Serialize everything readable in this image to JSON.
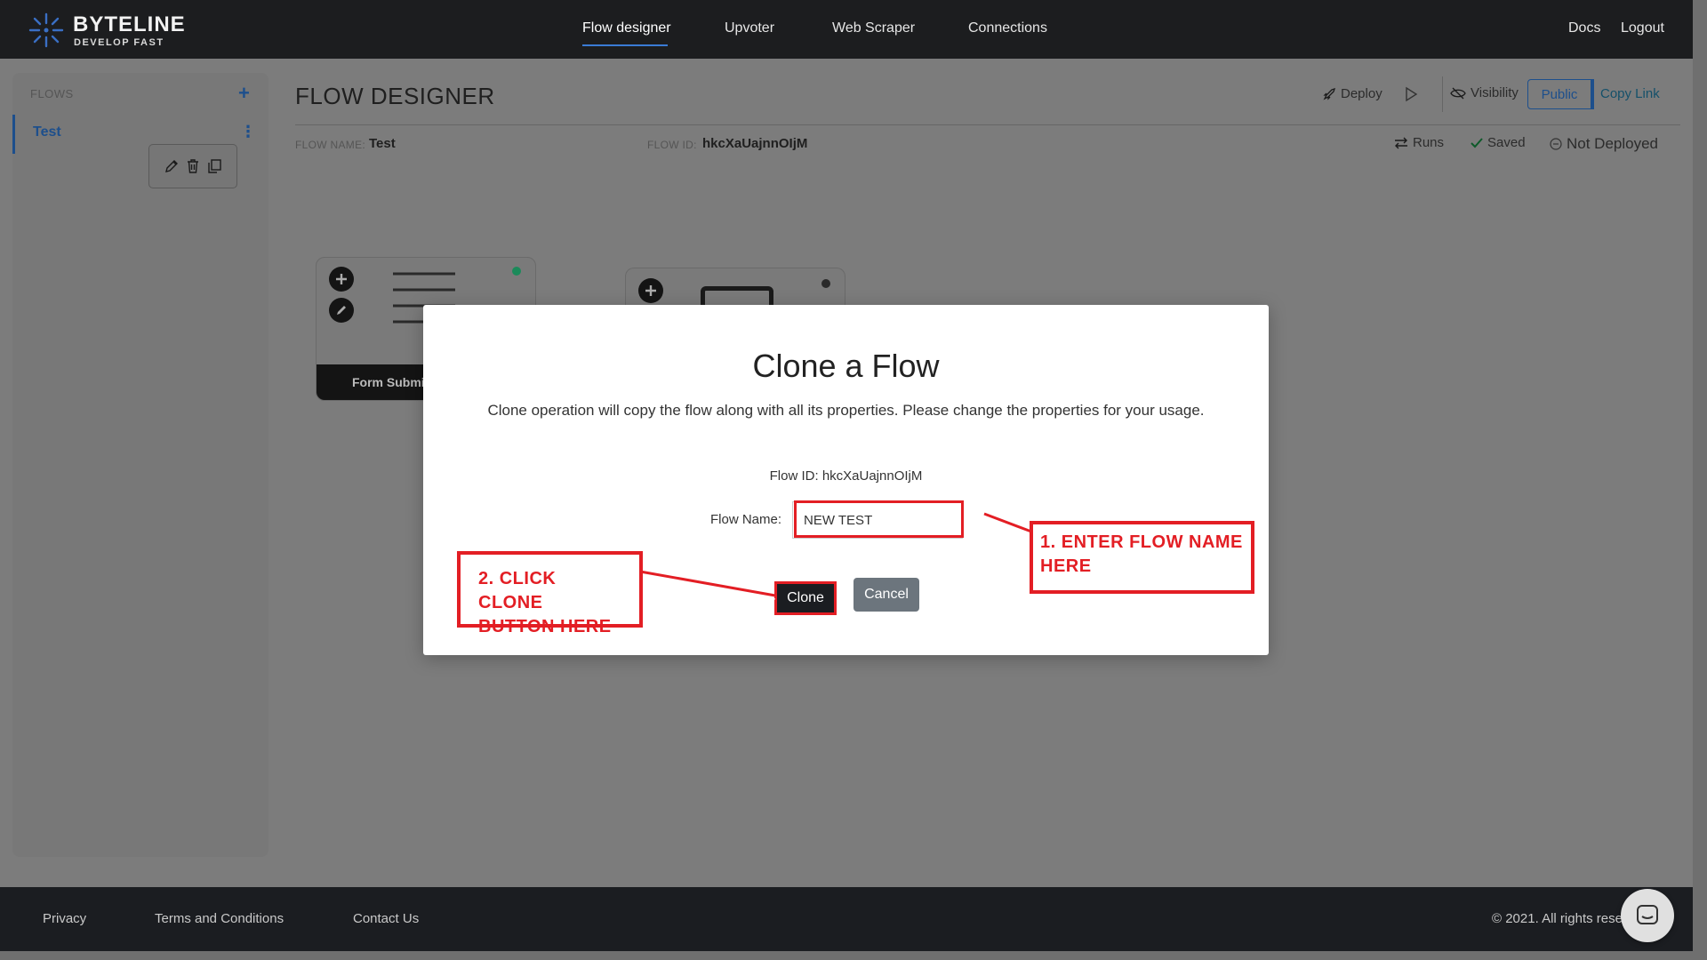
{
  "brand": {
    "name": "BYTELINE",
    "tagline": "DEVELOP FAST"
  },
  "nav": {
    "items": [
      {
        "label": "Flow designer",
        "active": true
      },
      {
        "label": "Upvoter"
      },
      {
        "label": "Web Scraper"
      },
      {
        "label": "Connections"
      }
    ],
    "docs": "Docs",
    "logout": "Logout"
  },
  "sidebar": {
    "title": "FLOWS",
    "add_icon": "plus-icon",
    "items": [
      {
        "label": "Test",
        "active": true
      }
    ],
    "item_actions": [
      "pencil-icon",
      "trash-icon",
      "copy-icon"
    ]
  },
  "header": {
    "title": "FLOW DESIGNER",
    "deploy": "Deploy",
    "visibility": "Visibility",
    "public": "Public",
    "copy_link": "Copy Link",
    "flow_name_label": "FLOW NAME:",
    "flow_name": "Test",
    "flow_id_label": "FLOW ID:",
    "flow_id": "hkcXaUajnnOIjM",
    "runs": "Runs",
    "saved": "Saved",
    "not_deployed": "Not Deployed"
  },
  "canvas": {
    "nodes": [
      {
        "label": "Form Submi",
        "status_color": "#1b8a5a"
      },
      {
        "label": "",
        "status_color": "#2a2a2a"
      }
    ]
  },
  "modal": {
    "title": "Clone a Flow",
    "description": "Clone operation will copy the flow along with all its properties. Please change the properties for your usage.",
    "flow_id_text": "Flow ID: hkcXaUajnnOIjM",
    "flow_name_label": "Flow Name:",
    "flow_name_value": "NEW TEST",
    "clone_label": "Clone",
    "cancel_label": "Cancel"
  },
  "annotations": {
    "step1_line1": "1. ENTER FLOW NAME",
    "step1_line2": "HERE",
    "step2_line1": "2. CLICK CLONE",
    "step2_line2": "BUTTON HERE",
    "color": "#e31e24"
  },
  "footer": {
    "privacy": "Privacy",
    "terms": "Terms and Conditions",
    "contact": "Contact Us",
    "copyright": "© 2021. All rights rese"
  }
}
